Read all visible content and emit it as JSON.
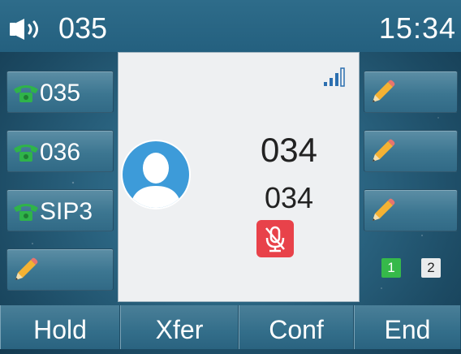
{
  "status_bar": {
    "speaker_icon": "speaker-volume-icon",
    "account": "035",
    "time": "15:34"
  },
  "line_keys_left": [
    {
      "label": "035",
      "icon": "phone-icon"
    },
    {
      "label": "036",
      "icon": "phone-icon"
    },
    {
      "label": "SIP3",
      "icon": "phone-icon"
    },
    {
      "label": "",
      "icon": "pencil-icon"
    }
  ],
  "line_keys_right": [
    {
      "label": "",
      "icon": "pencil-icon"
    },
    {
      "label": "",
      "icon": "pencil-icon"
    },
    {
      "label": "",
      "icon": "pencil-icon"
    }
  ],
  "call": {
    "name": "034",
    "number": "034",
    "signal_icon": "signal-strength-icon",
    "avatar_icon": "contact-avatar-icon",
    "mute_icon": "microphone-muted-icon"
  },
  "account_indicators": [
    "1",
    "2"
  ],
  "softkeys": [
    "Hold",
    "Xfer",
    "Conf",
    "End"
  ],
  "colors": {
    "phone_green": "#2fb34a",
    "mute_red": "#e8424a",
    "avatar_blue": "#3d9bd9",
    "active_account_green": "#36b94a",
    "background_teal": "#2b6582"
  }
}
